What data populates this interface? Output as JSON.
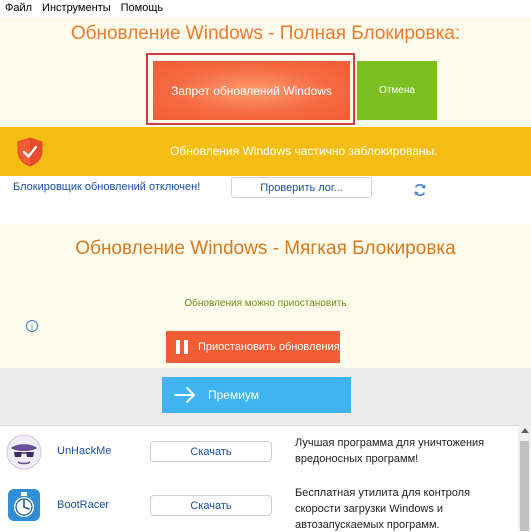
{
  "menu": [
    "Файл",
    "Инструменты",
    "Помощь"
  ],
  "full_lock": {
    "title": "Обновление Windows - Полная Блокировка:",
    "block_button": "Запрет обновлений Windows",
    "cancel_button": "Отмена"
  },
  "status": {
    "text": "Обновления Windows частично заблокированы.",
    "icon": "shield-check-icon"
  },
  "blocker": {
    "text": "Блокировщик обновлений отключен!",
    "log_button": "Проверить лог...",
    "refresh_icon": "refresh-icon"
  },
  "soft_lock": {
    "title": "Обновление Windows - Мягкая Блокировка",
    "subtitle": "Обновления можно приостановить",
    "info_icon": "i",
    "pause_button": "Приостановить обновления"
  },
  "premium": {
    "button": "Премиум"
  },
  "products": [
    {
      "name": "UnHackMe",
      "download": "Скачать",
      "description": "Лучшая программа для уничтожения вредоносных программ!",
      "icon": "unhackme-icon"
    },
    {
      "name": "BootRacer",
      "download": "Скачать",
      "description": "Бесплатная утилита для контроля скорости загрузки Windows и автозапускаемых программ.",
      "icon": "bootracer-icon"
    }
  ],
  "colors": {
    "accent_orange": "#f25d36",
    "accent_green": "#7cbf23",
    "banner_yellow": "#f3bd14",
    "premium_blue": "#3fb4f0"
  }
}
